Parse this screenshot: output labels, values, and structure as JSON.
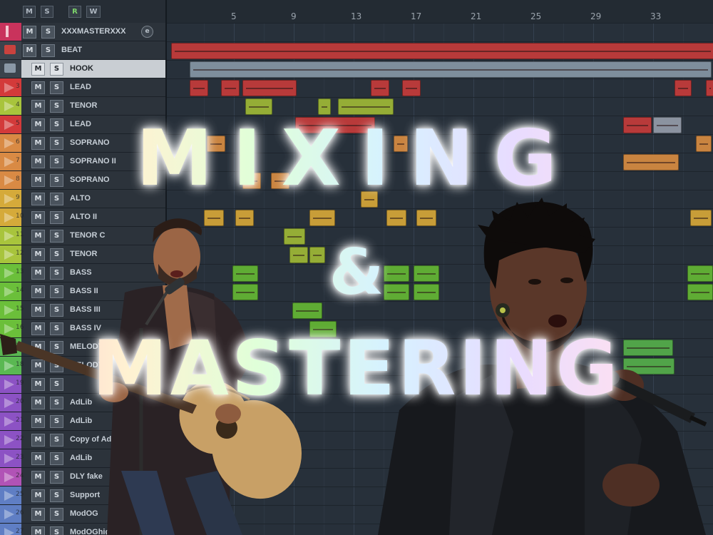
{
  "toolbar": {
    "buttons": [
      {
        "label": "M",
        "name": "mute-all-button"
      },
      {
        "label": "S",
        "name": "solo-all-button"
      },
      {
        "label": "R",
        "name": "record-arm-all-button"
      },
      {
        "label": "W",
        "name": "write-all-button"
      }
    ]
  },
  "ruler": {
    "bars": [
      "5",
      "9",
      "13",
      "17",
      "21",
      "25",
      "29",
      "33"
    ]
  },
  "tracks": [
    {
      "num": "",
      "name": "XXXMASTERXXX",
      "color": "#c9335c",
      "kind": "master"
    },
    {
      "num": "",
      "name": "BEAT",
      "color": "#c9423e",
      "kind": "folder"
    },
    {
      "num": "",
      "name": "HOOK",
      "color": "#8a98a6",
      "kind": "folder",
      "selected": true
    },
    {
      "num": "3",
      "name": "LEAD",
      "color": "#d33a3a"
    },
    {
      "num": "4",
      "name": "TENOR",
      "color": "#a8c43c"
    },
    {
      "num": "5",
      "name": "LEAD",
      "color": "#d33a3a"
    },
    {
      "num": "6",
      "name": "SOPRANO",
      "color": "#d98a44"
    },
    {
      "num": "7",
      "name": "SOPRANO II",
      "color": "#d98a44"
    },
    {
      "num": "8",
      "name": "SOPRANO",
      "color": "#d98a44"
    },
    {
      "num": "9",
      "name": "ALTO",
      "color": "#d5aa3a"
    },
    {
      "num": "10",
      "name": "ALTO II",
      "color": "#d5aa3a"
    },
    {
      "num": "11",
      "name": "TENOR C",
      "color": "#a8c43c"
    },
    {
      "num": "12",
      "name": "TENOR",
      "color": "#a8c43c"
    },
    {
      "num": "13",
      "name": "BASS",
      "color": "#6bbf3a"
    },
    {
      "num": "14",
      "name": "BASS II",
      "color": "#6bbf3a"
    },
    {
      "num": "15",
      "name": "BASS III",
      "color": "#6bbf3a"
    },
    {
      "num": "16",
      "name": "BASS IV",
      "color": "#6bbf3a"
    },
    {
      "num": "17",
      "name": "MELODY",
      "color": "#5ab852"
    },
    {
      "num": "18",
      "name": "MELODY",
      "color": "#5ab852"
    },
    {
      "num": "19",
      "name": "",
      "color": "#8c52c4"
    },
    {
      "num": "20",
      "name": "AdLib",
      "color": "#8c52c4"
    },
    {
      "num": "21",
      "name": "AdLib",
      "color": "#8c52c4"
    },
    {
      "num": "22",
      "name": "Copy of AdLib",
      "color": "#8c52c4"
    },
    {
      "num": "23",
      "name": "AdLib",
      "color": "#8c52c4"
    },
    {
      "num": "24",
      "name": "DLY fake",
      "color": "#b153b6"
    },
    {
      "num": "25",
      "name": "Support",
      "color": "#5f7ec4"
    },
    {
      "num": "26",
      "name": "ModOG",
      "color": "#5f7ec4"
    },
    {
      "num": "27",
      "name": "ModOGhigh",
      "color": "#5f7ec4"
    }
  ],
  "overlay": {
    "line1": "MIXING",
    "line2": "&",
    "line3": "MASTERING"
  },
  "icons": {
    "edit": "e",
    "master_icon": "master-flag-icon",
    "folder_icon": "folder-icon",
    "track_icon": "track-flag-icon"
  }
}
